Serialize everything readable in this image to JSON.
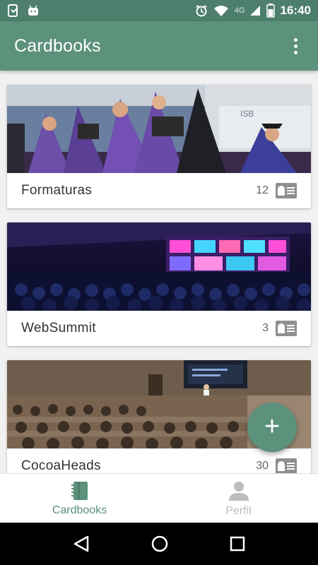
{
  "status_bar": {
    "time": "16:40",
    "network": "4G"
  },
  "app_bar": {
    "title": "Cardbooks",
    "overflow_icon": "more-vert-icon"
  },
  "cardbooks": [
    {
      "title": "Formaturas",
      "count": "12"
    },
    {
      "title": "WebSummit",
      "count": "3"
    },
    {
      "title": "CocoaHeads",
      "count": "30"
    }
  ],
  "fab": {
    "label": "+"
  },
  "bottom_nav": {
    "items": [
      {
        "label": "Cardbooks",
        "icon": "notebook-icon",
        "active": true
      },
      {
        "label": "Perfil",
        "icon": "person-icon",
        "active": false
      }
    ]
  },
  "colors": {
    "primary": "#5c917c",
    "primary_dark": "#4d7f6c",
    "icon_gray": "#8f8f8f"
  }
}
